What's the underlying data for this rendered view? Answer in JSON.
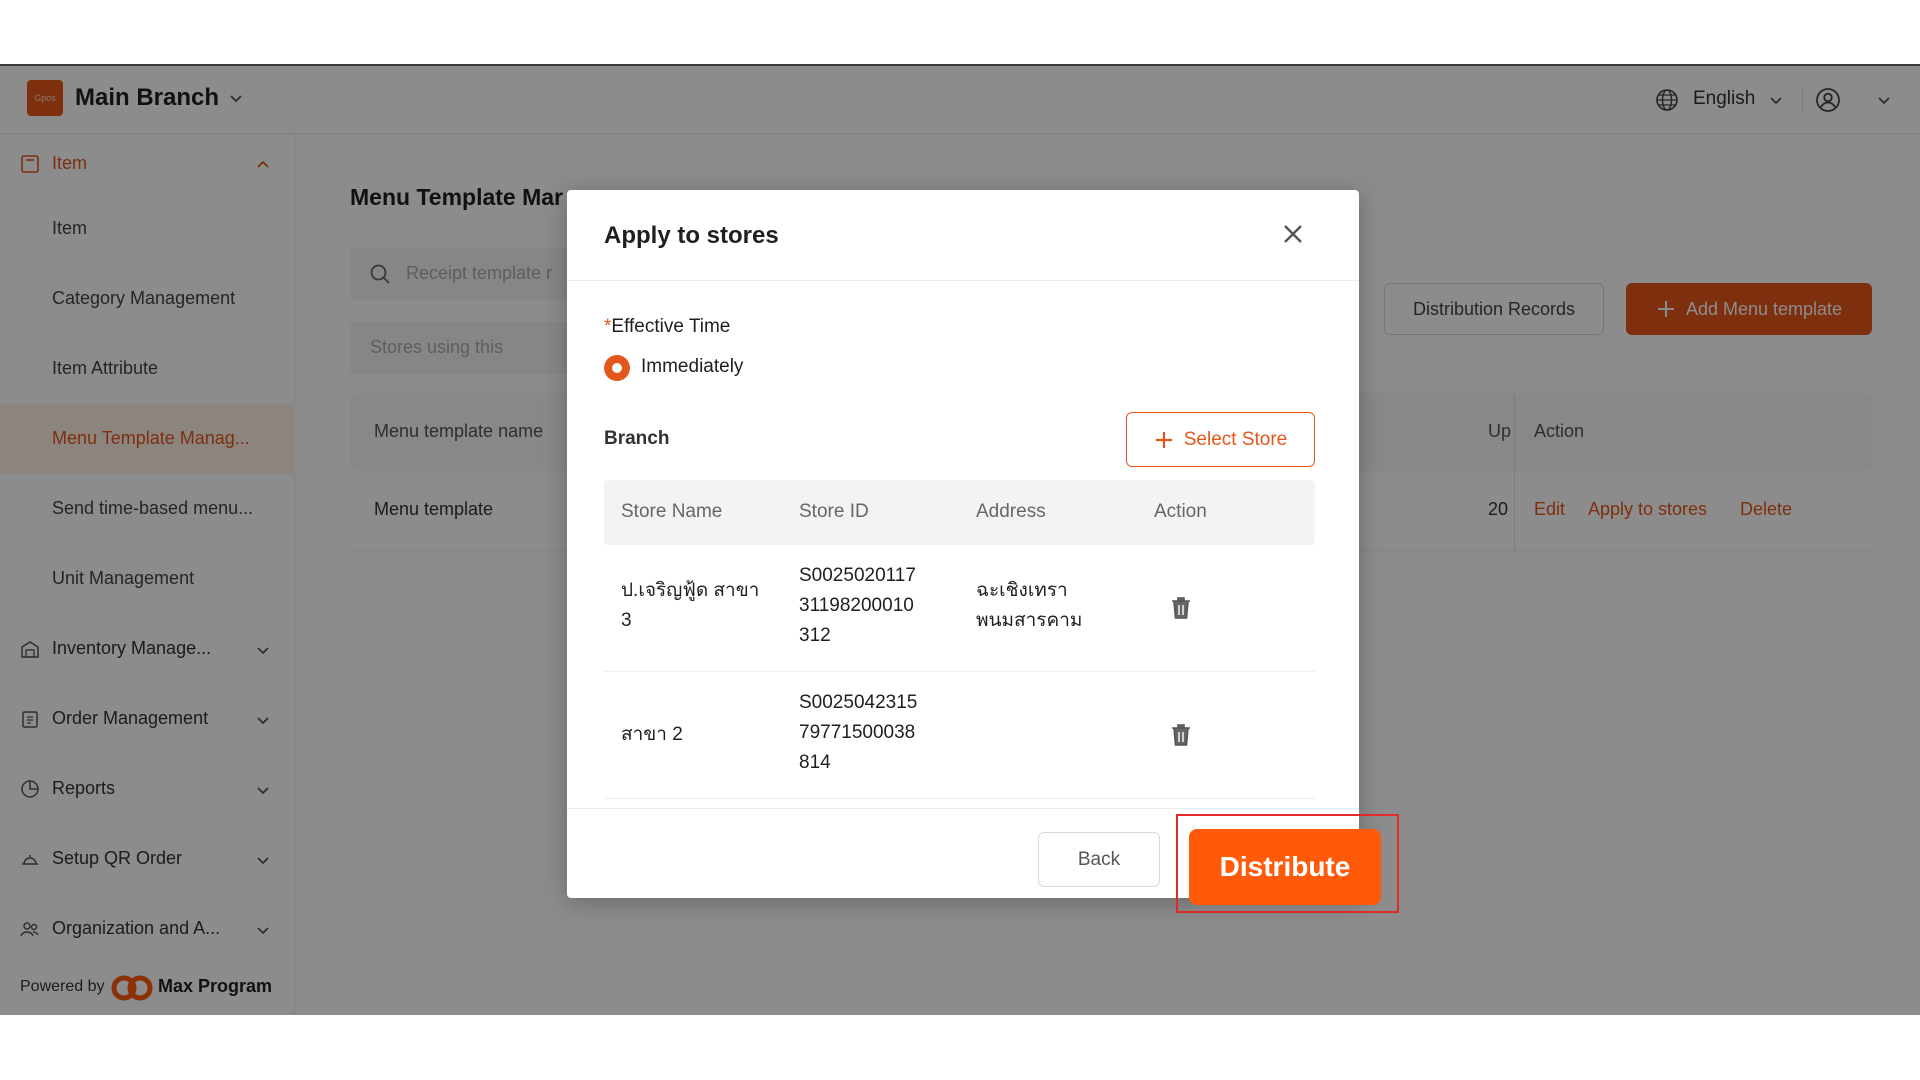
{
  "header": {
    "logo_text": "Gpos",
    "branch_name": "Main Branch",
    "language": "English"
  },
  "sidebar": {
    "group_item": "Item",
    "sub_items": [
      "Item",
      "Category Management",
      "Item Attribute",
      "Menu Template Manag...",
      "Send time-based menu...",
      "Unit Management"
    ],
    "groups": [
      "Inventory Manage...",
      "Order Management",
      "Reports",
      "Setup QR Order",
      "Organization and A..."
    ],
    "powered_by": "Powered by",
    "brand": "Max Program"
  },
  "main": {
    "title": "Menu Template Mar",
    "search_placeholder": "Receipt template r",
    "stores_placeholder": "Stores using this",
    "distribution_records": "Distribution Records",
    "add_template": "Add Menu template",
    "table": {
      "col_name": "Menu template name",
      "col_up": "Up",
      "col_action": "Action",
      "row_name": "Menu template",
      "row_up": "20",
      "edit": "Edit",
      "apply": "Apply to stores",
      "delete": "Delete"
    }
  },
  "modal": {
    "title": "Apply to stores",
    "effective_required": "*",
    "effective_label": "Effective Time",
    "radio_immediately": "Immediately",
    "branch_label": "Branch",
    "select_store": "Select Store",
    "columns": [
      "Store Name",
      "Store ID",
      "Address",
      "Action"
    ],
    "stores": [
      {
        "name_l1": "ป.เจริญฟู้ด สาขา",
        "name_l2": "3",
        "id_l1": "S0025020117",
        "id_l2": "31198200010",
        "id_l3": "312",
        "addr_l1": "ฉะเชิงเทรา",
        "addr_l2": "พนมสารคาม"
      },
      {
        "name_l1": "สาขา 2",
        "name_l2": "",
        "id_l1": "S0025042315",
        "id_l2": "79771500038",
        "id_l3": "814",
        "addr_l1": "",
        "addr_l2": ""
      }
    ],
    "back": "Back",
    "distribute": "Distribute"
  },
  "colors": {
    "accent": "#e4571a",
    "highlight": "#e22a2a"
  }
}
